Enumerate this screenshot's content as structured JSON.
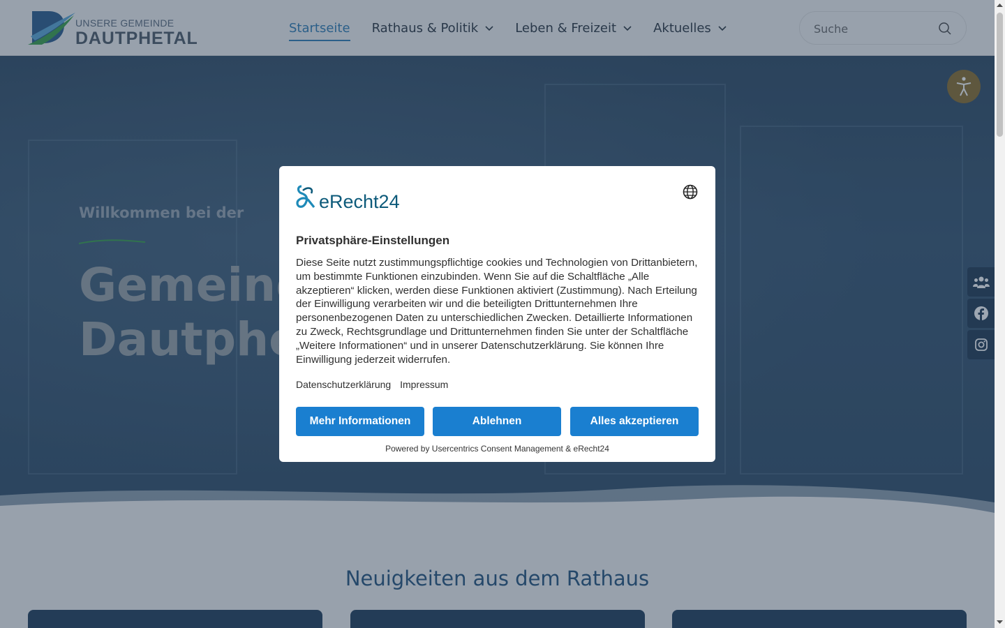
{
  "header": {
    "logo_small": "UNSERE GEMEINDE",
    "logo_big": "DAUTPHETAL",
    "nav": [
      {
        "label": "Startseite"
      },
      {
        "label": "Rathaus & Politik"
      },
      {
        "label": "Leben & Freizeit"
      },
      {
        "label": "Aktuelles"
      }
    ],
    "search_placeholder": "Suche"
  },
  "hero": {
    "subtitle": "Willkommen bei der",
    "title_line1": "Gemeinde",
    "title_line2": "Dautphetal"
  },
  "section": {
    "title": "Neuigkeiten aus dem Rathaus"
  },
  "consent": {
    "brand": "eRecht24",
    "heading": "Privatsphäre-Einstellungen",
    "body": "Diese Seite nutzt zustimmungspflichtige cookies und Technologien von Drittanbietern, um bestimmte Funktionen einzubinden. Wenn Sie auf die Schaltfläche „Alle akzeptieren“ klicken, werden diese Funktionen aktiviert (Zustimmung). Nach Erteilung der Einwilligung verarbeiten wir und die beteiligten Drittunternehmen Ihre personenbezogenen Daten zu unterschiedlichen Zwecken. Detaillierte Informationen zu Zweck, Rechtsgrundlage und Drittunternehmen finden Sie unter der Schaltfläche „Weitere Informationen“ und in unserer Datenschutzerklärung. Sie können Ihre Einwilligung jederzeit widerrufen.",
    "link_privacy": "Datenschutzerklärung",
    "link_imprint": "Impressum",
    "btn_more": "Mehr Informationen",
    "btn_decline": "Ablehnen",
    "btn_accept": "Alles akzeptieren",
    "powered": "Powered by Usercentrics Consent Management & eRecht24"
  },
  "colors": {
    "accent": "#2e7cb4",
    "button": "#1a7fd0",
    "navy": "#1f3952",
    "a11y": "#8a6e2c"
  },
  "icons": [
    "search-icon",
    "chevron-down-icon",
    "accessibility-icon",
    "group-icon",
    "facebook-icon",
    "instagram-icon",
    "globe-icon"
  ]
}
